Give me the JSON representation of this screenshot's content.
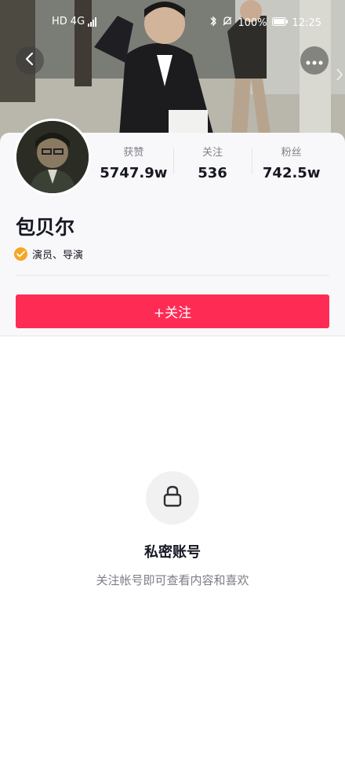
{
  "status_bar": {
    "left_labels": [
      "HD",
      "4G"
    ],
    "battery": "100%",
    "time": "12:25"
  },
  "nav": {
    "back_icon": "chevron-left-icon",
    "more_icon": "more-dots-icon"
  },
  "profile": {
    "name": "包贝尔",
    "verified_icon": "verified-check-icon",
    "verified_color": "#f5a623",
    "verification": "演员、导演"
  },
  "stats": [
    {
      "label": "获赞",
      "value": "5747.9w"
    },
    {
      "label": "关注",
      "value": "536"
    },
    {
      "label": "粉丝",
      "value": "742.5w"
    }
  ],
  "actions": {
    "follow_label": "+关注",
    "follow_color": "#fe2c55"
  },
  "private": {
    "icon": "lock-icon",
    "title": "私密账号",
    "subtitle": "关注帐号即可查看内容和喜欢"
  }
}
